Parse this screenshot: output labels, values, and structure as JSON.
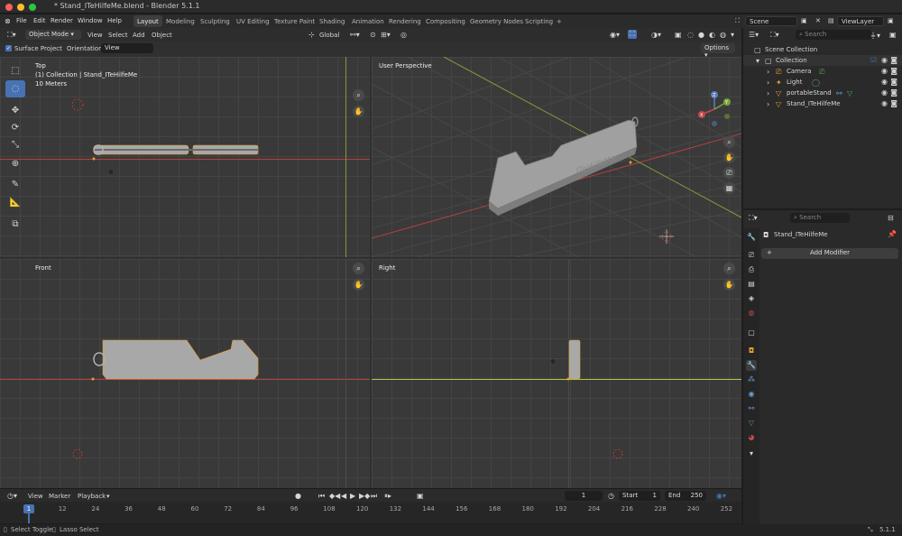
{
  "window": {
    "title": "* Stand_ITeHilfeMe.blend - Blender 5.1.1",
    "traffic_lights": [
      "#fe5f57",
      "#febc2e",
      "#28c840"
    ]
  },
  "menu": [
    "File",
    "Edit",
    "Render",
    "Window",
    "Help"
  ],
  "workspaces": [
    "Layout",
    "Modeling",
    "Sculpting",
    "UV Editing",
    "Texture Paint",
    "Shading",
    "Animation",
    "Rendering",
    "Compositing",
    "Geometry Nodes",
    "Scripting"
  ],
  "workspace_add": "+",
  "scene": {
    "name": "Scene",
    "view_layer": "ViewLayer"
  },
  "viewport_header": {
    "mode": "Object Mode",
    "menus": [
      "View",
      "Select",
      "Add",
      "Object"
    ],
    "transform_orientation": "Global",
    "options_label": "Options"
  },
  "tool_settings": {
    "surface_project": "Surface Project",
    "orientation_label": "Orientation:",
    "orientation_value": "View"
  },
  "views": {
    "top": {
      "name": "Top",
      "collection": "(1) Collection | Stand_ITeHilfeMe",
      "scale": "10 Meters"
    },
    "perspective": {
      "name": "User Perspective"
    },
    "front": {
      "name": "Front"
    },
    "right": {
      "name": "Right"
    }
  },
  "model_text": "ITeHilfeMe",
  "timeline": {
    "menus": [
      "View",
      "Marker",
      "Playback"
    ],
    "current_frame": "1",
    "start_label": "Start",
    "start": "1",
    "end_label": "End",
    "end": "250",
    "ticks": [
      "1",
      "12",
      "24",
      "36",
      "48",
      "60",
      "72",
      "84",
      "96",
      "108",
      "120",
      "132",
      "144",
      "156",
      "168",
      "180",
      "192",
      "204",
      "216",
      "228",
      "240",
      "252"
    ]
  },
  "outliner": {
    "search_placeholder": "Search",
    "root": "Scene Collection",
    "collection": "Collection",
    "items": [
      {
        "name": "Camera",
        "icon": "camera-icon"
      },
      {
        "name": "Light",
        "icon": "light-icon"
      },
      {
        "name": "portableStand",
        "icon": "mesh-icon"
      },
      {
        "name": "Stand_ITeHilfeMe",
        "icon": "mesh-icon"
      }
    ]
  },
  "properties": {
    "search_placeholder": "Search",
    "object_name": "Stand_ITeHilfeMe",
    "add_modifier": "Add Modifier"
  },
  "status": {
    "select_toggle": "Select Toggle",
    "lasso_select": "Lasso Select",
    "version": "5.1.1"
  },
  "colors": {
    "accent": "#4772b3",
    "x_axis": "#b3403f",
    "y_axis": "#7d9b3a",
    "mesh": "#a8a8a8",
    "selection_outline": "#e8a030"
  }
}
